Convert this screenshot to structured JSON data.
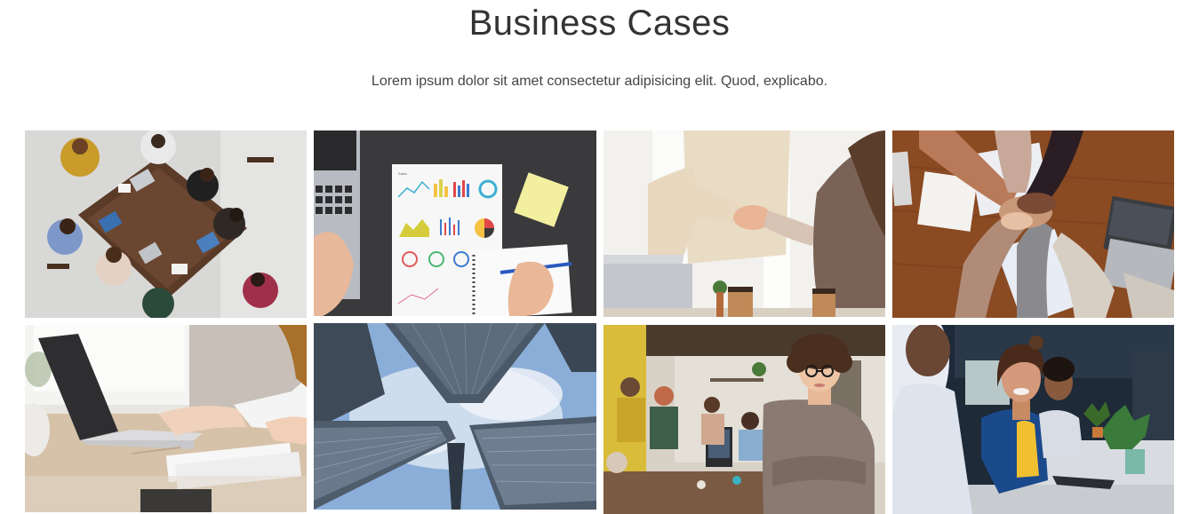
{
  "section": {
    "title": "Business Cases",
    "subtitle": "Lorem ipsum dolor sit amet consectetur adipisicing elit. Quod, explicabo."
  },
  "gallery": {
    "images": [
      {
        "name": "team-meeting-overhead-photo"
      },
      {
        "name": "financial-charts-desk-photo"
      },
      {
        "name": "handshake-photo"
      },
      {
        "name": "hands-stacked-teamwork-photo"
      },
      {
        "name": "laptop-typing-photo"
      },
      {
        "name": "skyscrapers-looking-up-photo"
      },
      {
        "name": "office-woman-arms-crossed-photo"
      },
      {
        "name": "smiling-coworkers-office-photo"
      }
    ]
  }
}
